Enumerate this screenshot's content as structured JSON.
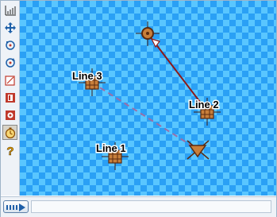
{
  "canvas": {
    "labels": {
      "line1": "Line 1",
      "line2": "Line 2",
      "line3": "Line 3"
    }
  },
  "toolbar": {
    "tools": [
      {
        "icon": "grid-icon"
      },
      {
        "icon": "move-icon"
      },
      {
        "icon": "add-point-icon"
      },
      {
        "icon": "rotate-icon"
      },
      {
        "icon": "resize-icon"
      },
      {
        "icon": "text-tool-icon"
      },
      {
        "icon": "image-icon"
      },
      {
        "icon": "timer-icon",
        "selected": true
      },
      {
        "icon": "help-icon"
      }
    ]
  },
  "colors": {
    "checker_dark": "#2aa0f5",
    "checker_light": "#59c6ff",
    "line_solid": "#8b1a1a",
    "line_dashed": "#9b6fa8",
    "target_fill": "#c87f3a"
  }
}
